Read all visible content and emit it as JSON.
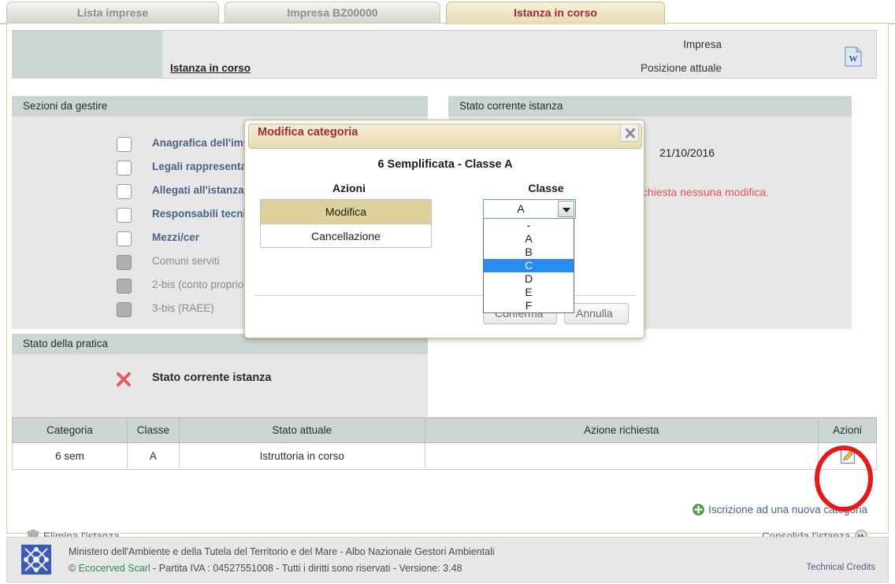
{
  "tabs": [
    {
      "label": "Lista imprese",
      "active": false
    },
    {
      "label": "Impresa BZ00000",
      "active": false
    },
    {
      "label": "Istanza in corso",
      "active": true
    }
  ],
  "breadcrumb": {
    "label_impresa": "Impresa",
    "value_impresa": "",
    "label_posizione": "Posizione attuale",
    "value_posizione": "Istanza in corso",
    "doc_icon": "word-document-icon"
  },
  "sections": {
    "left_header": "Sezioni da gestire",
    "right_header": "Stato corrente istanza",
    "practice_header": "Stato della pratica"
  },
  "checklist": [
    {
      "label": "Anagrafica dell'impresa",
      "disabled": false
    },
    {
      "label": "Legali rappresentanti",
      "disabled": false
    },
    {
      "label": "Allegati all'istanza",
      "disabled": false
    },
    {
      "label": "Responsabili tecnici",
      "disabled": false
    },
    {
      "label": "Mezzi/cer",
      "disabled": false
    },
    {
      "label": "Comuni serviti",
      "disabled": true
    },
    {
      "label": "2-bis (conto proprio)",
      "disabled": true
    },
    {
      "label": "3-bis (RAEE)",
      "disabled": true
    }
  ],
  "current_state": {
    "date": "21/10/2016",
    "message": "Non e' stata richiesta nessuna modifica."
  },
  "practice": {
    "icon": "red-x-icon",
    "label": "Stato corrente istanza"
  },
  "table": {
    "columns": [
      "Categoria",
      "Classe",
      "Stato attuale",
      "Azione richiesta",
      "Azioni"
    ],
    "rows": [
      {
        "categoria": "6 sem",
        "classe": "A",
        "stato_attuale": "Istruttoria in corso",
        "azione_richiesta": "",
        "azioni_icon": "edit-pencil-icon"
      }
    ]
  },
  "actions": {
    "new_category": "Iscrizione ad una nuova categoria",
    "new_category_icon": "plus-circle-icon",
    "delete_instance": "Elimina l'istanza",
    "delete_icon": "trash-icon",
    "consolidate": "Consolida l'istanza",
    "consolidate_icon": "double-arrow-icon"
  },
  "modal": {
    "title": "Modifica categoria",
    "close_icon": "close-x-icon",
    "subtitle": "6 Semplificata - Classe A",
    "azioni_header": "Azioni",
    "classe_header": "Classe",
    "azioni_options": [
      {
        "label": "Modifica",
        "selected": true
      },
      {
        "label": "Cancellazione",
        "selected": false
      }
    ],
    "select": {
      "value": "A",
      "open": true,
      "options": [
        "-",
        "A",
        "B",
        "C",
        "D",
        "E",
        "F"
      ],
      "highlighted": "C"
    },
    "confirm": "Conferma",
    "cancel": "Annulla"
  },
  "footer": {
    "logo": "ministry-logo-icon",
    "line1": "Ministero dell'Ambiente e della Tutela del Territorio e del Mare - Albo Nazionale Gestori Ambientali",
    "line2_prefix": "© ",
    "line2_company": "Ecocerved Scarl",
    "line2_rest": " - Partita IVA : 04527551008 - Tutti i diritti sono riservati - Versione: 3.48",
    "credits": "Technical Credits"
  },
  "colors": {
    "accent_red": "#9d2b33",
    "tab_active_bg": "#eee4c4",
    "section_bar": "#cbd5d3",
    "link_blue": "#4b6285",
    "highlight_blue": "#2a8cf0",
    "annotation_red": "#e31b1b"
  }
}
